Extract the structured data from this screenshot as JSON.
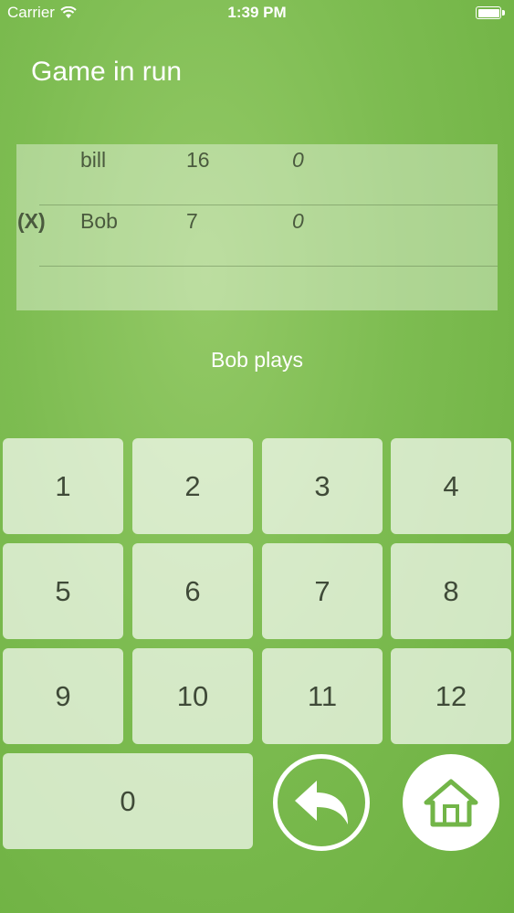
{
  "status_bar": {
    "carrier": "Carrier",
    "time": "1:39 PM"
  },
  "title": "Game in run",
  "players": [
    {
      "marker": "",
      "name": "bill",
      "score": "16",
      "extra": "0"
    },
    {
      "marker": "(X)",
      "name": "Bob",
      "score": "7",
      "extra": "0"
    }
  ],
  "status_text": "Bob plays",
  "keypad": {
    "keys": [
      "1",
      "2",
      "3",
      "4",
      "5",
      "6",
      "7",
      "8",
      "9",
      "10",
      "11",
      "12"
    ],
    "zero": "0"
  },
  "icons": {
    "undo": "undo-arrow-icon",
    "home": "home-icon"
  },
  "colors": {
    "background": "#7dbc51",
    "accent": "#6cb040",
    "text": "#ffffff"
  }
}
